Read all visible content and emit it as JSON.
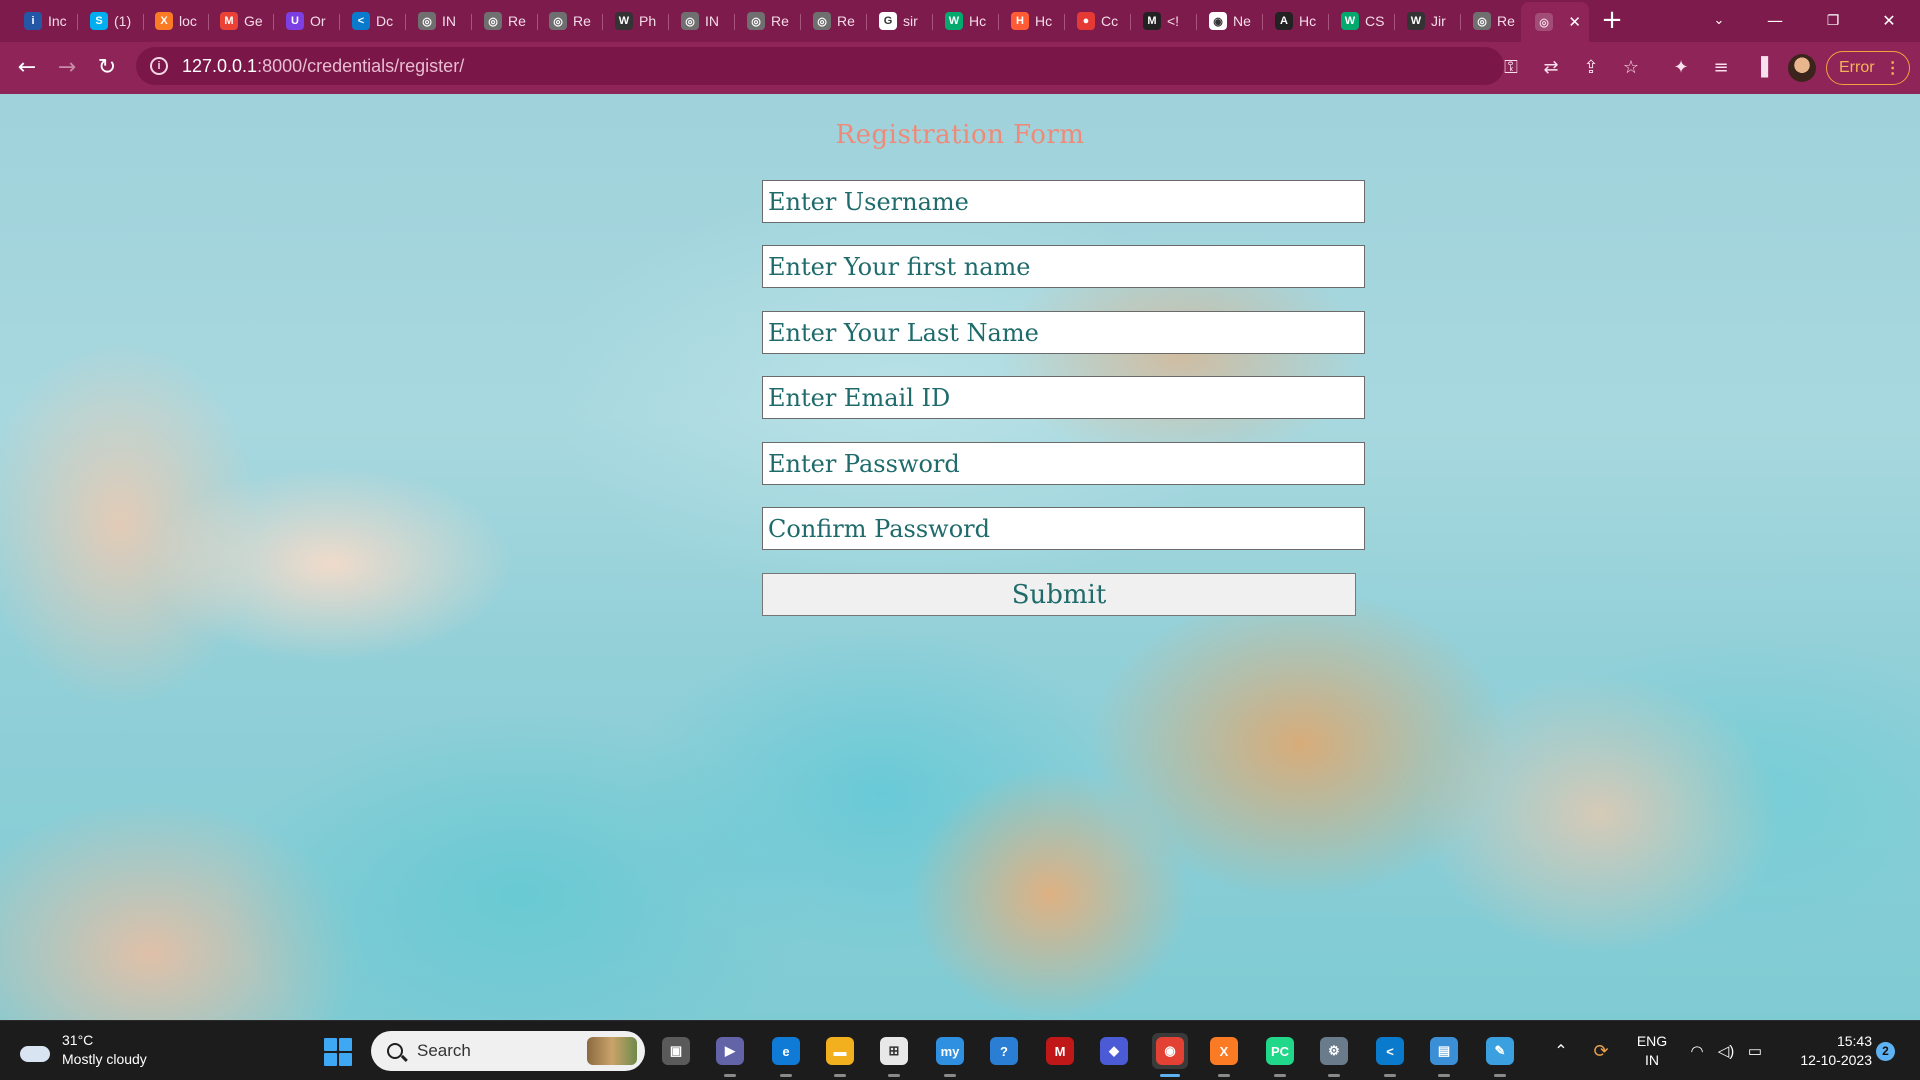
{
  "browser": {
    "tabs": [
      {
        "label": "Inc",
        "favicon": "indeed-icon",
        "color": "#2557a7",
        "glyph": "i"
      },
      {
        "label": "(1)",
        "favicon": "skype-icon",
        "color": "#00aff0",
        "glyph": "S"
      },
      {
        "label": "loc",
        "favicon": "xampp-icon",
        "color": "#fb7a24",
        "glyph": "X"
      },
      {
        "label": "Ge",
        "favicon": "gmail-icon",
        "color": "#ea4335",
        "glyph": "M"
      },
      {
        "label": "Or",
        "favicon": "uworld-icon",
        "color": "#7b3fe4",
        "glyph": "U"
      },
      {
        "label": "Dc",
        "favicon": "vscode-icon",
        "color": "#0a7acc",
        "glyph": "<"
      },
      {
        "label": "IN",
        "favicon": "globe-icon",
        "color": "#6f6f6f",
        "glyph": "◎"
      },
      {
        "label": "Re",
        "favicon": "globe-icon",
        "color": "#6f6f6f",
        "glyph": "◎"
      },
      {
        "label": "Re",
        "favicon": "globe-icon",
        "color": "#6f6f6f",
        "glyph": "◎"
      },
      {
        "label": "Ph",
        "favicon": "wr-icon",
        "color": "#333333",
        "glyph": "W"
      },
      {
        "label": "IN",
        "favicon": "globe-icon",
        "color": "#6f6f6f",
        "glyph": "◎"
      },
      {
        "label": "Re",
        "favicon": "globe-icon",
        "color": "#6f6f6f",
        "glyph": "◎"
      },
      {
        "label": "Re",
        "favicon": "globe-icon",
        "color": "#6f6f6f",
        "glyph": "◎"
      },
      {
        "label": "sir",
        "favicon": "google-icon",
        "color": "#ffffff",
        "glyph": "G"
      },
      {
        "label": "Hc",
        "favicon": "w3schools-icon",
        "color": "#04aa6d",
        "glyph": "W"
      },
      {
        "label": "Hc",
        "favicon": "hubspot-icon",
        "color": "#ff5c35",
        "glyph": "H"
      },
      {
        "label": "Cc",
        "favicon": "record-icon",
        "color": "#e53935",
        "glyph": "●"
      },
      {
        "label": "<!",
        "favicon": "m-icon",
        "color": "#222222",
        "glyph": "M"
      },
      {
        "label": "Ne",
        "favicon": "chrome-icon",
        "color": "#ffffff",
        "glyph": "◉"
      },
      {
        "label": "Hc",
        "favicon": "a-icon",
        "color": "#222222",
        "glyph": "A"
      },
      {
        "label": "CS",
        "favicon": "w3schools-icon",
        "color": "#04aa6d",
        "glyph": "W"
      },
      {
        "label": "Jir",
        "favicon": "wr-icon",
        "color": "#333333",
        "glyph": "W"
      },
      {
        "label": "Re",
        "favicon": "globe-icon",
        "color": "#6f6f6f",
        "glyph": "◎"
      }
    ],
    "active_tab": {
      "label": "",
      "favicon": "globe-icon"
    },
    "address": {
      "host": "127.0.0.1",
      "path": ":8000/credentials/register/"
    },
    "error_label": "Error"
  },
  "page": {
    "title": "Registration Form",
    "fields": [
      {
        "name": "username-input",
        "placeholder": "Enter Username"
      },
      {
        "name": "first-name-input",
        "placeholder": "Enter Your first name"
      },
      {
        "name": "last-name-input",
        "placeholder": "Enter Your Last Name"
      },
      {
        "name": "email-input",
        "placeholder": "Enter Email ID"
      },
      {
        "name": "password-input",
        "placeholder": "Enter Password"
      },
      {
        "name": "confirm-password-input",
        "placeholder": "Confirm Password"
      }
    ],
    "submit_label": "Submit"
  },
  "taskbar": {
    "weather": {
      "temp": "31°C",
      "condition": "Mostly cloudy"
    },
    "search_label": "Search",
    "apps": [
      {
        "name": "task-view-icon",
        "glyph": "▣",
        "color": "#5a5a5a"
      },
      {
        "name": "meet-icon",
        "glyph": "▶",
        "color": "#6264a7"
      },
      {
        "name": "edge-icon",
        "glyph": "e",
        "color": "#0f7bd6"
      },
      {
        "name": "file-explorer-icon",
        "glyph": "▬",
        "color": "#f2b01e"
      },
      {
        "name": "store-icon",
        "glyph": "⊞",
        "color": "#e8e8e8"
      },
      {
        "name": "mylio-icon",
        "glyph": "my",
        "color": "#2f8fe0"
      },
      {
        "name": "help-icon",
        "glyph": "?",
        "color": "#2a7fd4"
      },
      {
        "name": "mcafee-icon",
        "glyph": "M",
        "color": "#c01818"
      },
      {
        "name": "copilot-icon",
        "glyph": "◆",
        "color": "#4b5bd6"
      },
      {
        "name": "chrome-icon",
        "glyph": "◉",
        "color": "#e34133"
      },
      {
        "name": "xampp-icon",
        "glyph": "X",
        "color": "#fb7a24"
      },
      {
        "name": "pycharm-icon",
        "glyph": "PC",
        "color": "#21d789"
      },
      {
        "name": "settings-icon",
        "glyph": "⚙",
        "color": "#6a7b8c"
      },
      {
        "name": "vscode-icon",
        "glyph": "<",
        "color": "#0a7acc"
      },
      {
        "name": "control-panel-icon",
        "glyph": "▤",
        "color": "#3a8fd6"
      },
      {
        "name": "paint-icon",
        "glyph": "✎",
        "color": "#3aa0e0"
      }
    ],
    "lang": {
      "line1": "ENG",
      "line2": "IN"
    },
    "clock": {
      "time": "15:43",
      "date": "12-10-2023"
    },
    "notifications": "2"
  }
}
